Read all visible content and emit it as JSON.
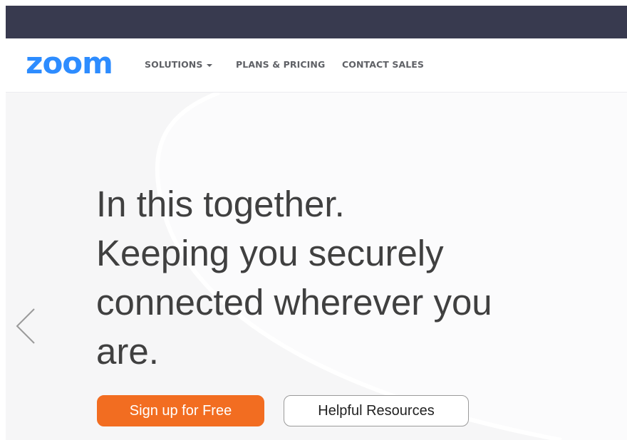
{
  "header": {
    "logo_text": "zoom",
    "nav": {
      "solutions": "SOLUTIONS",
      "plans": "PLANS & PRICING",
      "contact": "CONTACT SALES"
    }
  },
  "hero": {
    "headline": [
      "In this together.",
      "Keeping you securely",
      "connected wherever you",
      "are."
    ],
    "buttons": {
      "signup": "Sign up for Free",
      "resources": "Helpful Resources"
    }
  },
  "colors": {
    "topbar": "#383a4f",
    "brand_blue": "#2d8cff",
    "signup_orange": "#f26d21",
    "hero_bg": "#f6f6f7"
  },
  "icons": {
    "solutions_dropdown": "caret-down-icon",
    "carousel": "chevron-left-icon"
  }
}
